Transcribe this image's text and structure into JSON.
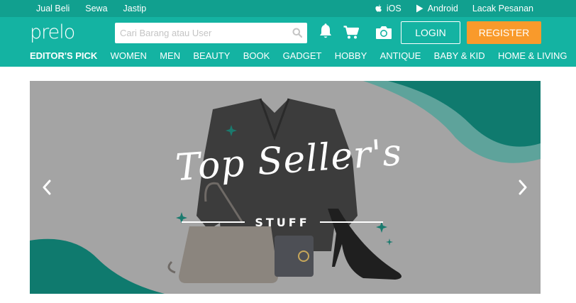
{
  "topbar": {
    "links": [
      "Jual Beli",
      "Sewa",
      "Jastip"
    ],
    "ios_label": "iOS",
    "android_label": "Android",
    "track_label": "Lacak Pesanan"
  },
  "header": {
    "logo": "prelo",
    "search_placeholder": "Cari Barang atau User",
    "login_label": "LOGIN",
    "register_label": "REGISTER",
    "categories": [
      "EDITOR'S PICK",
      "WOMEN",
      "MEN",
      "BEAUTY",
      "BOOK",
      "GADGET",
      "HOBBY",
      "ANTIQUE",
      "BABY & KID",
      "HOME & LIVING"
    ]
  },
  "banner": {
    "headline": "Top Seller's",
    "subheadline": "STUFF"
  },
  "colors": {
    "topbar": "#11a08f",
    "header": "#14b3a2",
    "register": "#f99a2b",
    "banner_bg": "#a4a4a4",
    "banner_accent": "#0f7a6e"
  }
}
